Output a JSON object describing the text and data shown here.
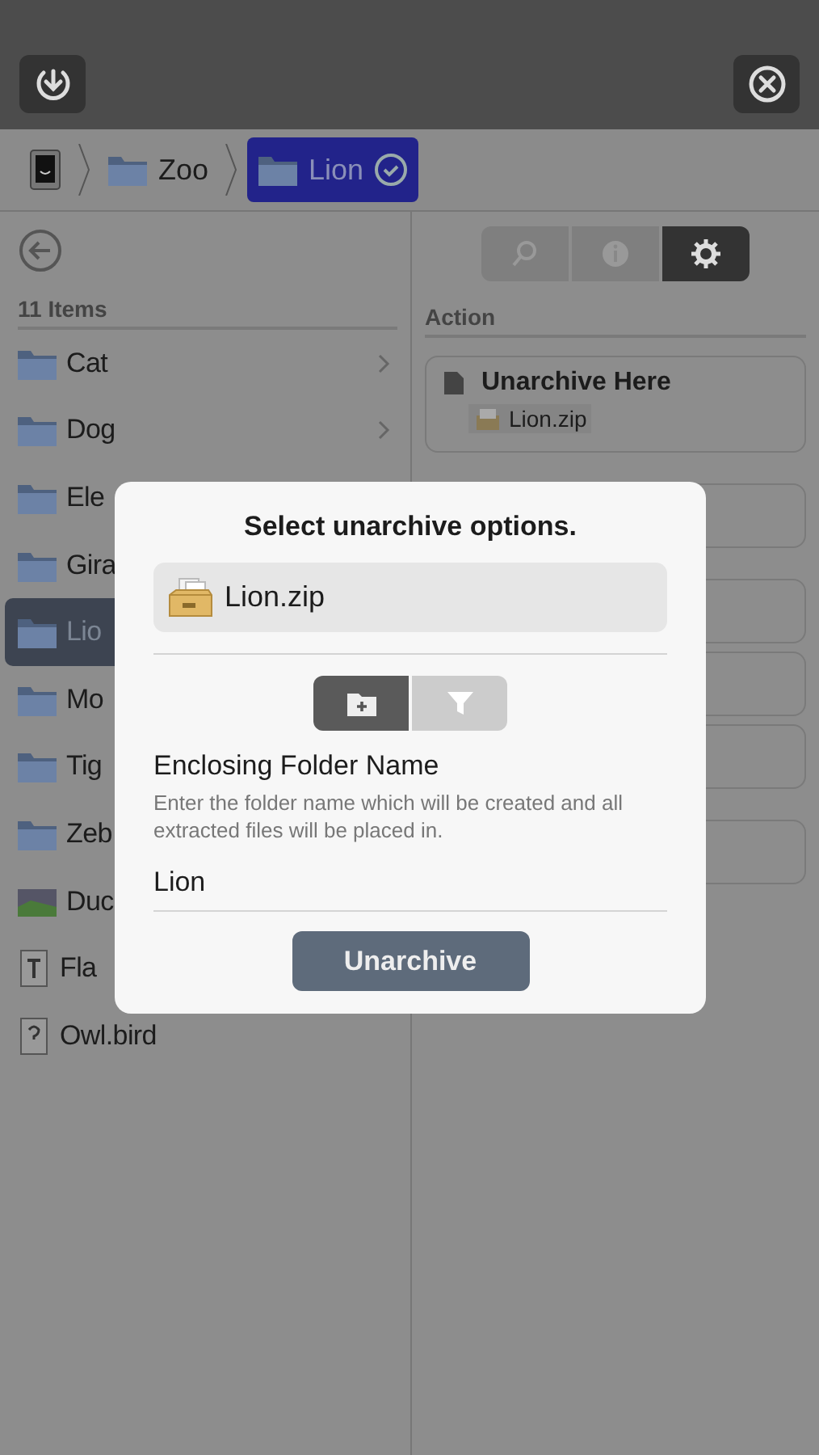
{
  "breadcrumb": [
    {
      "kind": "device",
      "selected": false
    },
    {
      "kind": "folder",
      "label": "Zoo",
      "selected": false
    },
    {
      "kind": "folder",
      "label": "Lion",
      "selected": true
    }
  ],
  "list": {
    "count": "11 Items",
    "items": [
      {
        "name": "Cat",
        "kind": "folder",
        "chevron": true,
        "selected": false
      },
      {
        "name": "Dog",
        "kind": "folder",
        "chevron": true,
        "selected": false
      },
      {
        "name": "Ele",
        "kind": "folder",
        "chevron": false,
        "selected": false
      },
      {
        "name": "Gira",
        "kind": "folder",
        "chevron": false,
        "selected": false
      },
      {
        "name": "Lio",
        "kind": "folder",
        "chevron": false,
        "selected": true
      },
      {
        "name": "Mo",
        "kind": "folder",
        "chevron": false,
        "selected": false
      },
      {
        "name": "Tig",
        "kind": "folder",
        "chevron": false,
        "selected": false
      },
      {
        "name": "Zeb",
        "kind": "folder",
        "chevron": false,
        "selected": false
      },
      {
        "name": "Duc",
        "kind": "image",
        "chevron": false,
        "selected": false
      },
      {
        "name": "Fla",
        "kind": "text",
        "chevron": false,
        "selected": false
      },
      {
        "name": "Owl.bird",
        "kind": "unknown",
        "chevron": false,
        "selected": false
      }
    ]
  },
  "panel": {
    "tabs": [
      {
        "kind": "search",
        "selected": false
      },
      {
        "kind": "info",
        "selected": false
      },
      {
        "kind": "settings",
        "selected": true
      }
    ],
    "heading": "Action",
    "action": {
      "title": "Unarchive Here",
      "file": "Lion.zip"
    }
  },
  "dialog": {
    "title": "Select unarchive options.",
    "file": "Lion.zip",
    "modes": [
      {
        "kind": "folder",
        "selected": true
      },
      {
        "kind": "filter",
        "selected": false
      }
    ],
    "field_label": "Enclosing Folder Name",
    "hint": "Enter the folder name which will be created and all extracted files will be placed in.",
    "value": "Lion",
    "button": "Unarchive"
  }
}
